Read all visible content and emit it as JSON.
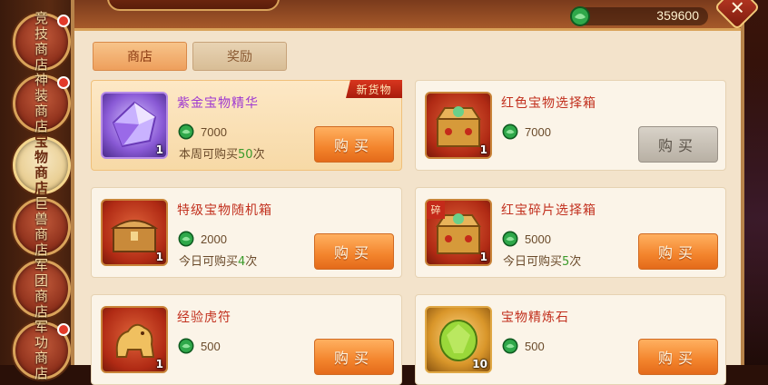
{
  "rail": {
    "tabs": [
      {
        "label": "竞技商店",
        "badge": true,
        "active": false
      },
      {
        "label": "神装商店",
        "badge": true,
        "active": false
      },
      {
        "label": "宝物商店",
        "badge": false,
        "active": true
      },
      {
        "label": "巨兽商店",
        "badge": false,
        "active": false
      },
      {
        "label": "军团商店",
        "badge": false,
        "active": false
      },
      {
        "label": "军功商店",
        "badge": true,
        "active": false
      }
    ]
  },
  "header": {
    "currency_value": "359600",
    "close_label": "✕"
  },
  "subtabs": [
    {
      "label": "商店",
      "active": true
    },
    {
      "label": "奖励",
      "active": false
    }
  ],
  "items": [
    {
      "name": "紫金宝物精华",
      "price": "7000",
      "limit_prefix": "本周可购买",
      "limit_num": "50",
      "limit_suffix": "次",
      "qty": "1",
      "badge": "新货物",
      "buy_label": "购买",
      "buy_enabled": true,
      "highlighted": true,
      "icon": "purple-crystal-icon"
    },
    {
      "name": "红色宝物选择箱",
      "price": "7000",
      "limit_prefix": "",
      "limit_num": "",
      "limit_suffix": "",
      "qty": "1",
      "badge": "",
      "buy_label": "购买",
      "buy_enabled": false,
      "highlighted": false,
      "icon": "red-treasure-chest-icon"
    },
    {
      "name": "特级宝物随机箱",
      "price": "2000",
      "limit_prefix": "今日可购买",
      "limit_num": "4",
      "limit_suffix": "次",
      "qty": "1",
      "badge": "",
      "buy_label": "购买",
      "buy_enabled": true,
      "highlighted": false,
      "icon": "gold-chest-icon"
    },
    {
      "name": "红宝碎片选择箱",
      "price": "5000",
      "limit_prefix": "今日可购买",
      "limit_num": "5",
      "limit_suffix": "次",
      "qty": "1",
      "badge": "",
      "tag": "碎",
      "buy_label": "购买",
      "buy_enabled": true,
      "highlighted": false,
      "icon": "red-fragment-chest-icon"
    },
    {
      "name": "经验虎符",
      "price": "500",
      "limit_prefix": "",
      "limit_num": "",
      "limit_suffix": "",
      "qty": "1",
      "badge": "",
      "buy_label": "购买",
      "buy_enabled": true,
      "highlighted": false,
      "icon": "tiger-tally-icon"
    },
    {
      "name": "宝物精炼石",
      "price": "500",
      "limit_prefix": "",
      "limit_num": "",
      "limit_suffix": "",
      "qty": "10",
      "badge": "",
      "buy_label": "购买",
      "buy_enabled": true,
      "highlighted": false,
      "icon": "green-refining-stone-icon"
    }
  ],
  "colors": {
    "accent": "#f3842c",
    "price_green": "#3a9a2a",
    "item_name_red": "#c2301e"
  }
}
